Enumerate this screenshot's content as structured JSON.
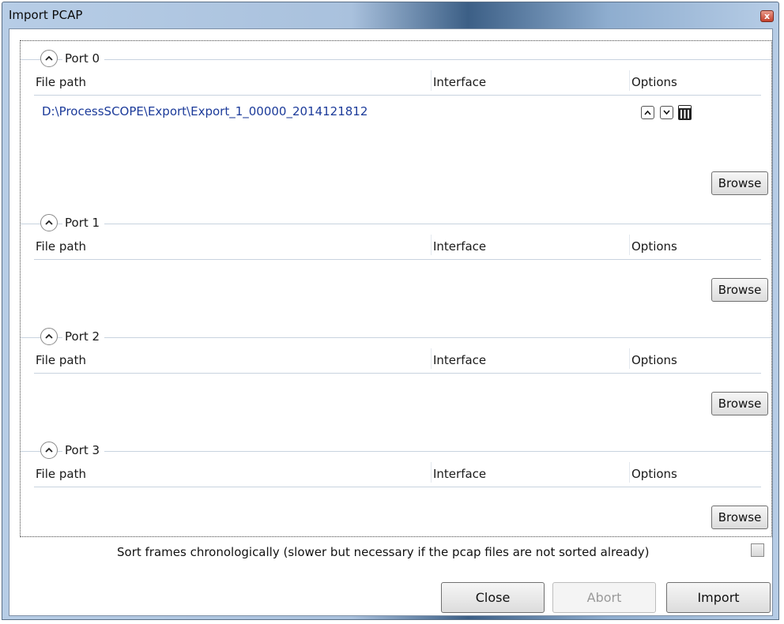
{
  "window": {
    "title": "Import PCAP",
    "close_glyph": "x"
  },
  "ports": [
    {
      "label": "Port  0",
      "columns": {
        "file_path": "File path",
        "interface": "Interface",
        "options": "Options"
      },
      "files": [
        {
          "path": "D:\\ProcessSCOPE\\Export\\Export_1_00000_2014121812",
          "interface": ""
        }
      ],
      "browse_label": "Browse"
    },
    {
      "label": "Port  1",
      "columns": {
        "file_path": "File path",
        "interface": "Interface",
        "options": "Options"
      },
      "files": [],
      "browse_label": "Browse"
    },
    {
      "label": "Port  2",
      "columns": {
        "file_path": "File path",
        "interface": "Interface",
        "options": "Options"
      },
      "files": [],
      "browse_label": "Browse"
    },
    {
      "label": "Port  3",
      "columns": {
        "file_path": "File path",
        "interface": "Interface",
        "options": "Options"
      },
      "files": [],
      "browse_label": "Browse"
    }
  ],
  "sort": {
    "label": "Sort frames chronologically (slower but necessary if the pcap files are not sorted already)",
    "checked": false
  },
  "buttons": {
    "close": "Close",
    "abort": "Abort",
    "import": "Import"
  },
  "icons": {
    "collapse": "chevron-up-icon",
    "move_up": "arrow-up-icon",
    "move_down": "arrow-down-icon",
    "delete": "trash-icon"
  }
}
